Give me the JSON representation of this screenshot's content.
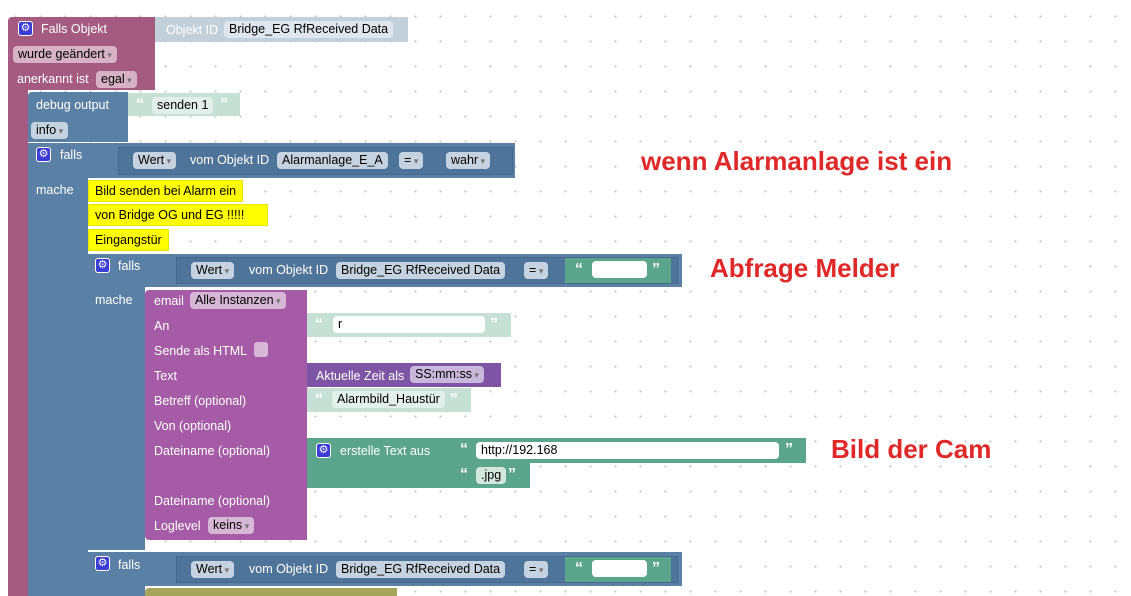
{
  "trigger": {
    "title": "Falls Objekt",
    "object_label": "Objekt ID",
    "object_id": "Bridge_EG RfReceived  Data",
    "event": "wurde geändert",
    "ack_label": "anerkannt ist",
    "ack_value": "egal"
  },
  "debug": {
    "label": "debug output",
    "text": "senden 1",
    "level": "info"
  },
  "if1": {
    "falls": "falls",
    "mache": "mache",
    "value": "Wert",
    "from": "vom Objekt ID",
    "object_id": "Alarmanlage_E_A",
    "op": "=",
    "compare": "wahr"
  },
  "comments": [
    "Bild senden bei Alarm ein",
    "von Bridge OG und  EG !!!!!",
    "Eingangstür"
  ],
  "if2": {
    "falls": "falls",
    "mache": "mache",
    "value": "Wert",
    "from": "vom Objekt ID",
    "object_id": "Bridge_EG RfReceived  Data",
    "op": "=",
    "compare": ""
  },
  "email": {
    "label": "email",
    "instance": "Alle Instanzen",
    "to_label": "An",
    "to_value": "r",
    "html_label": "Sende als HTML",
    "text_label": "Text",
    "time_label": "Aktuelle Zeit als",
    "time_format": "SS:mm:ss",
    "subject_label": "Betreff (optional)",
    "subject_value": "Alarmbild_Haustür",
    "from_label": "Von (optional)",
    "file1_label": "Dateiname (optional)",
    "join_label": "erstelle Text aus",
    "url": "http://192.168",
    "ext": ".jpg",
    "file2_label": "Dateiname (optional)",
    "loglevel_label": "Loglevel",
    "loglevel": "keins"
  },
  "if3": {
    "falls": "falls",
    "value": "Wert",
    "from": "vom Objekt ID",
    "object_id": "Bridge_EG RfReceived  Data",
    "op": "=",
    "compare": ""
  },
  "annotations": {
    "alarm": "wenn Alarmanlage ist ein",
    "melder": "Abfrage Melder",
    "cam": "Bild der Cam"
  },
  "colors": {
    "event_block": "#a55b80",
    "logic_block": "#5b80a5",
    "email_block": "#a55ba5",
    "text_block": "#5ba58c",
    "annotation": "#e02828",
    "comment": "#ffff00"
  }
}
